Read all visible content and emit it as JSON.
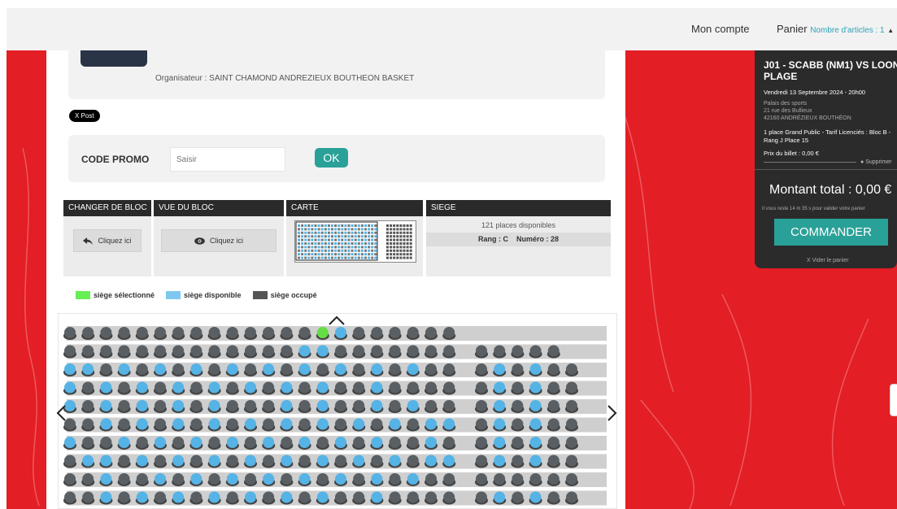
{
  "topbar": {
    "account_label": "Mon compte",
    "cart_label": "Panier",
    "cart_count": "Nombre d'articles : 1",
    "caret": "▲"
  },
  "organizer": {
    "text": "Organisateur : SAINT CHAMOND ANDREZIEUX BOUTHEON BASKET"
  },
  "share": {
    "xpost_label": "X Post"
  },
  "promo": {
    "label": "CODE PROMO",
    "placeholder": "Saisir",
    "ok_label": "OK"
  },
  "panels": {
    "change_block": {
      "title": "CHANGER DE BLOC",
      "button": "Cliquez ici"
    },
    "block_view": {
      "title": "VUE DU BLOC",
      "button": "Cliquez ici"
    },
    "map": {
      "title": "CARTE"
    },
    "seat": {
      "title": "SIEGE",
      "available": "121 places disponibles",
      "rank_label": "Rang : C",
      "number_label": "Numéro : 28"
    }
  },
  "legend": {
    "selected": "siège sélectionné",
    "available": "siège disponible",
    "occupied": "siège occupé"
  },
  "colors": {
    "red_bg": "#e31e24",
    "accent": "#2aa198",
    "seat_selected": "#66dd44",
    "seat_available": "#55b3e6",
    "seat_occupied": "#5a5f63",
    "dark": "#2b2b2b"
  },
  "seatmap": {
    "rows": [
      "OOOOOOOOOOOOOOSAOOOOOO",
      "OOOOOOOOOOOOOAAOOOOOOO|OOOOO",
      "AAOAOAOAOAOAOAOAOAOAOO|OAOAOO",
      "AOAOAOAOAOAOAOAOOAOOOO|OAOAOO",
      "AOAOAOAOAOOOAOAOOAOAOO|OAOAOO",
      "OOAOAOAOAOAOAOAOAOAOAA|OAOAOO",
      "AOOAOAOAOAOAOAOAOAOOAO|OAOAOO",
      "OAAOAOAOAOAOAOAOAOAOAA|OAOAOO",
      "OOAOOAOAOAOAOAOAOAOAOO|OOOOOO",
      "OOAOAOAOAOAOAOAOOAOOOO|OAOAOO"
    ]
  },
  "cart": {
    "title": "J01 - SCABB (NM1) VS LOON PLAGE",
    "date": "Vendredi 13 Septembre 2024 - 20h00",
    "venue_lines": [
      "Palais des sports",
      "21 rue des Bullieux",
      "42160 ANDRÉZIEUX BOUTHÉON"
    ],
    "ticket_line": "1 place Grand Public - Tarif Licenciés : Bloc B - Rang J Place 15",
    "price": "Prix du billet : 0,00 €",
    "remove_label": "Supprimer",
    "total": "Montant total : 0,00 €",
    "time_left": "Il vous reste 14 m 35 s pour valider votre panier",
    "order_label": "COMMANDER",
    "empty_label": "X Vider le panier"
  }
}
